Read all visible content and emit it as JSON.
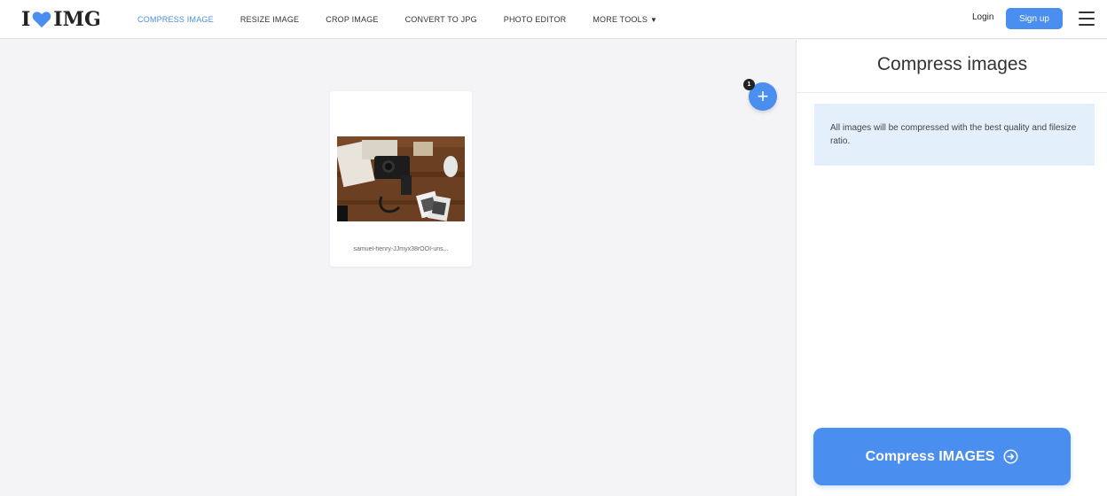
{
  "header": {
    "logo_prefix": "I",
    "logo_suffix": "IMG",
    "nav": [
      {
        "label": "Compress image",
        "active": true
      },
      {
        "label": "Resize image"
      },
      {
        "label": "Crop image"
      },
      {
        "label": "Convert to JPG"
      },
      {
        "label": "Photo editor"
      },
      {
        "label": "More tools"
      }
    ],
    "login_label": "Login",
    "signup_label": "Sign up"
  },
  "workspace": {
    "file": {
      "name": "samuel-henry-JJmyx38rOOI-uns..."
    },
    "file_count": "1",
    "add_label": "+"
  },
  "sidebar": {
    "title": "Compress images",
    "info": "All images will be compressed with the best quality and filesize ratio.",
    "action_label": "Compress IMAGES"
  },
  "colors": {
    "accent": "#4a8ef0",
    "info_bg": "#e4effc",
    "heart": "#4a8ef0"
  }
}
